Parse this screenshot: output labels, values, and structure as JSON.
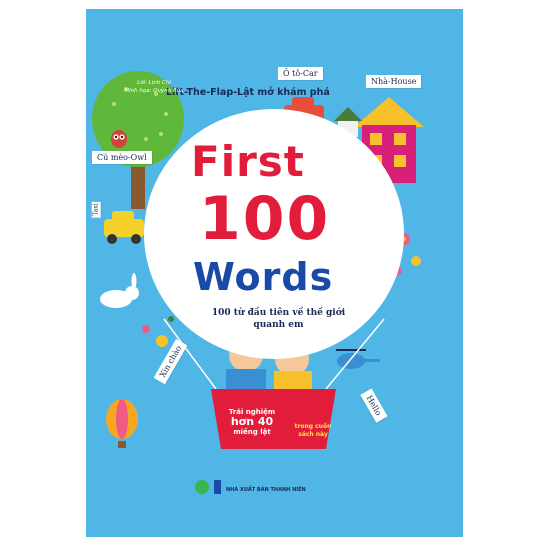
{
  "series": "Lift-The-Flap-Lật mở khám phá",
  "title": {
    "line1": "First",
    "line2": "100",
    "line3": "Words"
  },
  "subtitle": "100 từ đầu tiên về thế giới quanh em",
  "credits": {
    "text": "Lời: Linh Chi",
    "illustration": "Minh họa: Quỳnh Rùa"
  },
  "signs": {
    "owl": "Cú mèo-Owl",
    "car": "Ô tô-Car",
    "house": "Nhà-House",
    "taxi": "Taxi",
    "hello_vi": "Xin chào",
    "hello_en": "Hello"
  },
  "badge": {
    "line1": "Trải nghiệm",
    "line2": "hơn 40",
    "line3": "miếng lật"
  },
  "inside": "trong cuốn sách này",
  "publisher": "NHÀ XUẤT BẢN THANH NIÊN",
  "colors": {
    "background": "#4fb6e6",
    "red": "#e21d3b",
    "blue": "#1a4aa8"
  }
}
